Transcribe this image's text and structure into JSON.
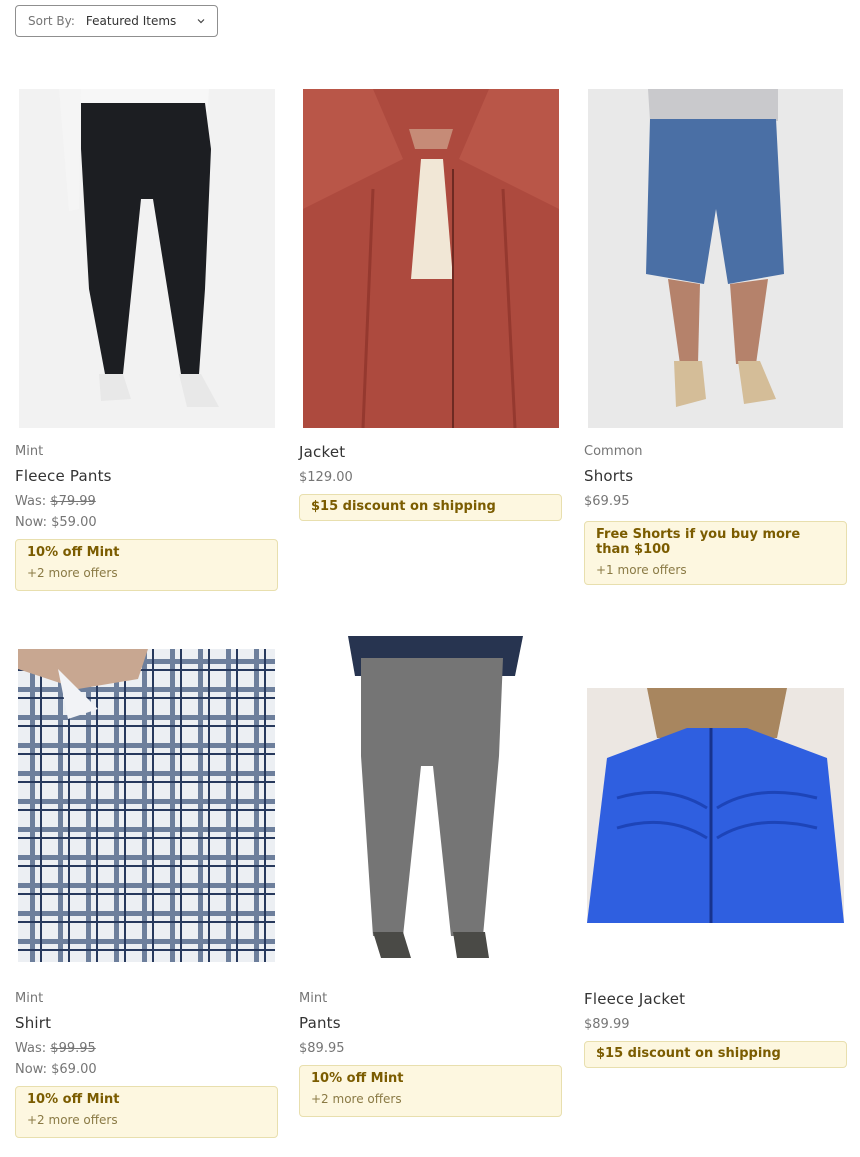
{
  "sort": {
    "label": "Sort By:",
    "value": "Featured Items"
  },
  "products": [
    {
      "brand": "Mint",
      "title": "Fleece Pants",
      "was_label": "Was:",
      "was": "$79.99",
      "now_label": "Now:",
      "now": "$59.00",
      "promo": "10% off Mint",
      "more": "+2 more offers"
    },
    {
      "brand": "",
      "title": "Jacket",
      "price": "$129.00",
      "promo": "$15 discount on shipping"
    },
    {
      "brand": "Common",
      "title": "Shorts",
      "price": "$69.95",
      "promo": "Free Shorts if you buy more than $100",
      "more": "+1 more offers"
    },
    {
      "brand": "Mint",
      "title": "Shirt",
      "was_label": "Was:",
      "was": "$99.95",
      "now_label": "Now:",
      "now": "$69.00",
      "promo": "10% off Mint",
      "more": "+2 more offers"
    },
    {
      "brand": "Mint",
      "title": "Pants",
      "price": "$89.95",
      "promo": "10% off Mint",
      "more": "+2 more offers"
    },
    {
      "brand": "",
      "title": "Fleece Jacket",
      "price": "$89.99",
      "promo": "$15 discount on shipping"
    }
  ]
}
